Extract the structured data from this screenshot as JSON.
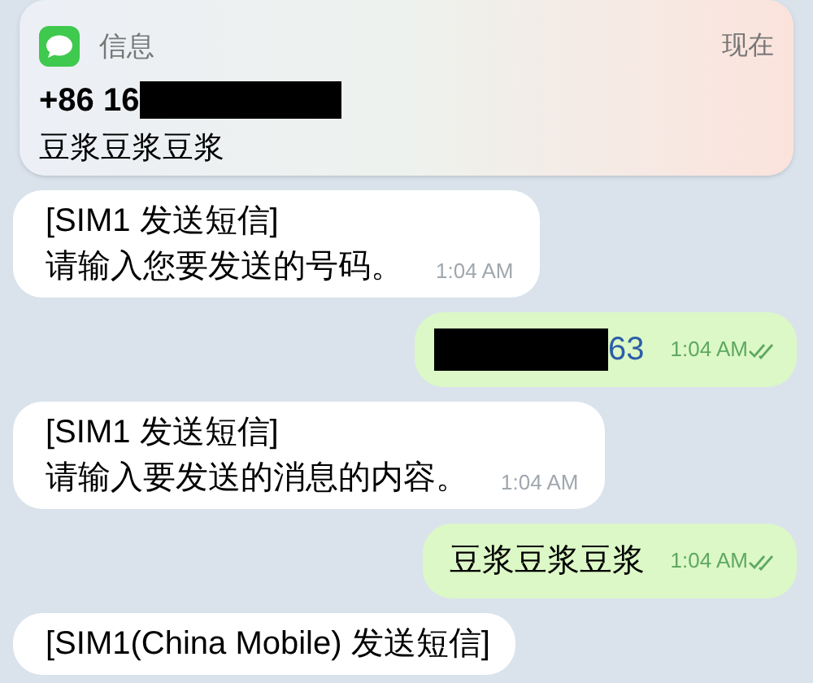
{
  "notification": {
    "app": "信息",
    "time": "现在",
    "sender": "+86 16",
    "sender_redacted": true,
    "body": "豆浆豆浆豆浆"
  },
  "messages": [
    {
      "kind": "incoming",
      "lines": [
        "[SIM1 发送短信]",
        "请输入您要发送的号码。"
      ],
      "time": "1:04 AM"
    },
    {
      "kind": "outgoing",
      "redacted": true,
      "text": "63",
      "link": true,
      "time": "1:04 AM",
      "read": true
    },
    {
      "kind": "incoming",
      "lines": [
        "[SIM1 发送短信]",
        "请输入要发送的消息的内容。"
      ],
      "time": "1:04 AM"
    },
    {
      "kind": "outgoing",
      "redacted": false,
      "text": "豆浆豆浆豆浆",
      "link": false,
      "time": "1:04 AM",
      "read": true
    },
    {
      "kind": "incoming",
      "lines": [
        "[SIM1(China Mobile) 发送短信]"
      ]
    }
  ]
}
